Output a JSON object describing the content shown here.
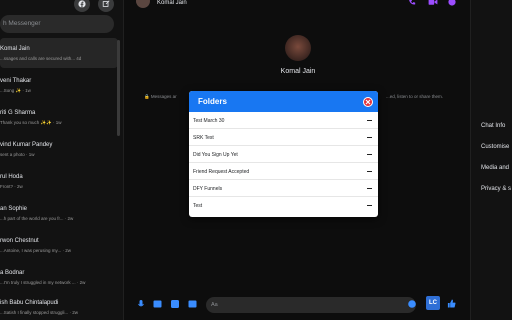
{
  "colors": {
    "brand_blue": "#1877f2",
    "close_red": "#e4333a",
    "accent_purple": "#9c4dff",
    "background": "#0a0a0a"
  },
  "sidebar": {
    "search_placeholder": "h Messenger",
    "conversations": [
      {
        "name": "Komal Jain",
        "snippet": "...ssages and calls are secured with...  4d"
      },
      {
        "name": "veni Thakar",
        "snippet": "...Song ✨ · 1w"
      },
      {
        "name": "riti G Sharma",
        "snippet": "Thank you so much ✨✨ · 1w"
      },
      {
        "name": "vind Kumar Pandey",
        "snippet": "sent a photo · 1w"
      },
      {
        "name": "rul Hoda",
        "snippet": "Front? · 2w"
      },
      {
        "name": "an Sophie",
        "snippet": "...h part of the world are you fr... · 2w"
      },
      {
        "name": "rwon Chestnut",
        "snippet": "...Antoine, I was perusing my... · 2w"
      },
      {
        "name": "a Bodnar",
        "snippet": "...I'm truly I struggled in my network ... · 2w"
      },
      {
        "name": "ish Babu Chintalapudi",
        "snippet": "...Satish I finally stopped struggli... · 2w"
      }
    ]
  },
  "chat": {
    "contact_name": "Komal Jain",
    "profile_name": "Komal Jain",
    "encryption_left": "🔒 Messages ar",
    "encryption_right": "...ed, listen to or share them.",
    "composer_placeholder": "Aa",
    "lc_label": "LC"
  },
  "right_panel": {
    "items": [
      "Chat Info",
      "Customise",
      "Media and",
      "Privacy & s"
    ]
  },
  "folders_modal": {
    "title": "Folders",
    "items": [
      "Test March 30",
      "SRK Test",
      "Did You Sign Up Yet",
      "Friend Request Accepted",
      "DFY Funnels",
      "Test"
    ]
  }
}
